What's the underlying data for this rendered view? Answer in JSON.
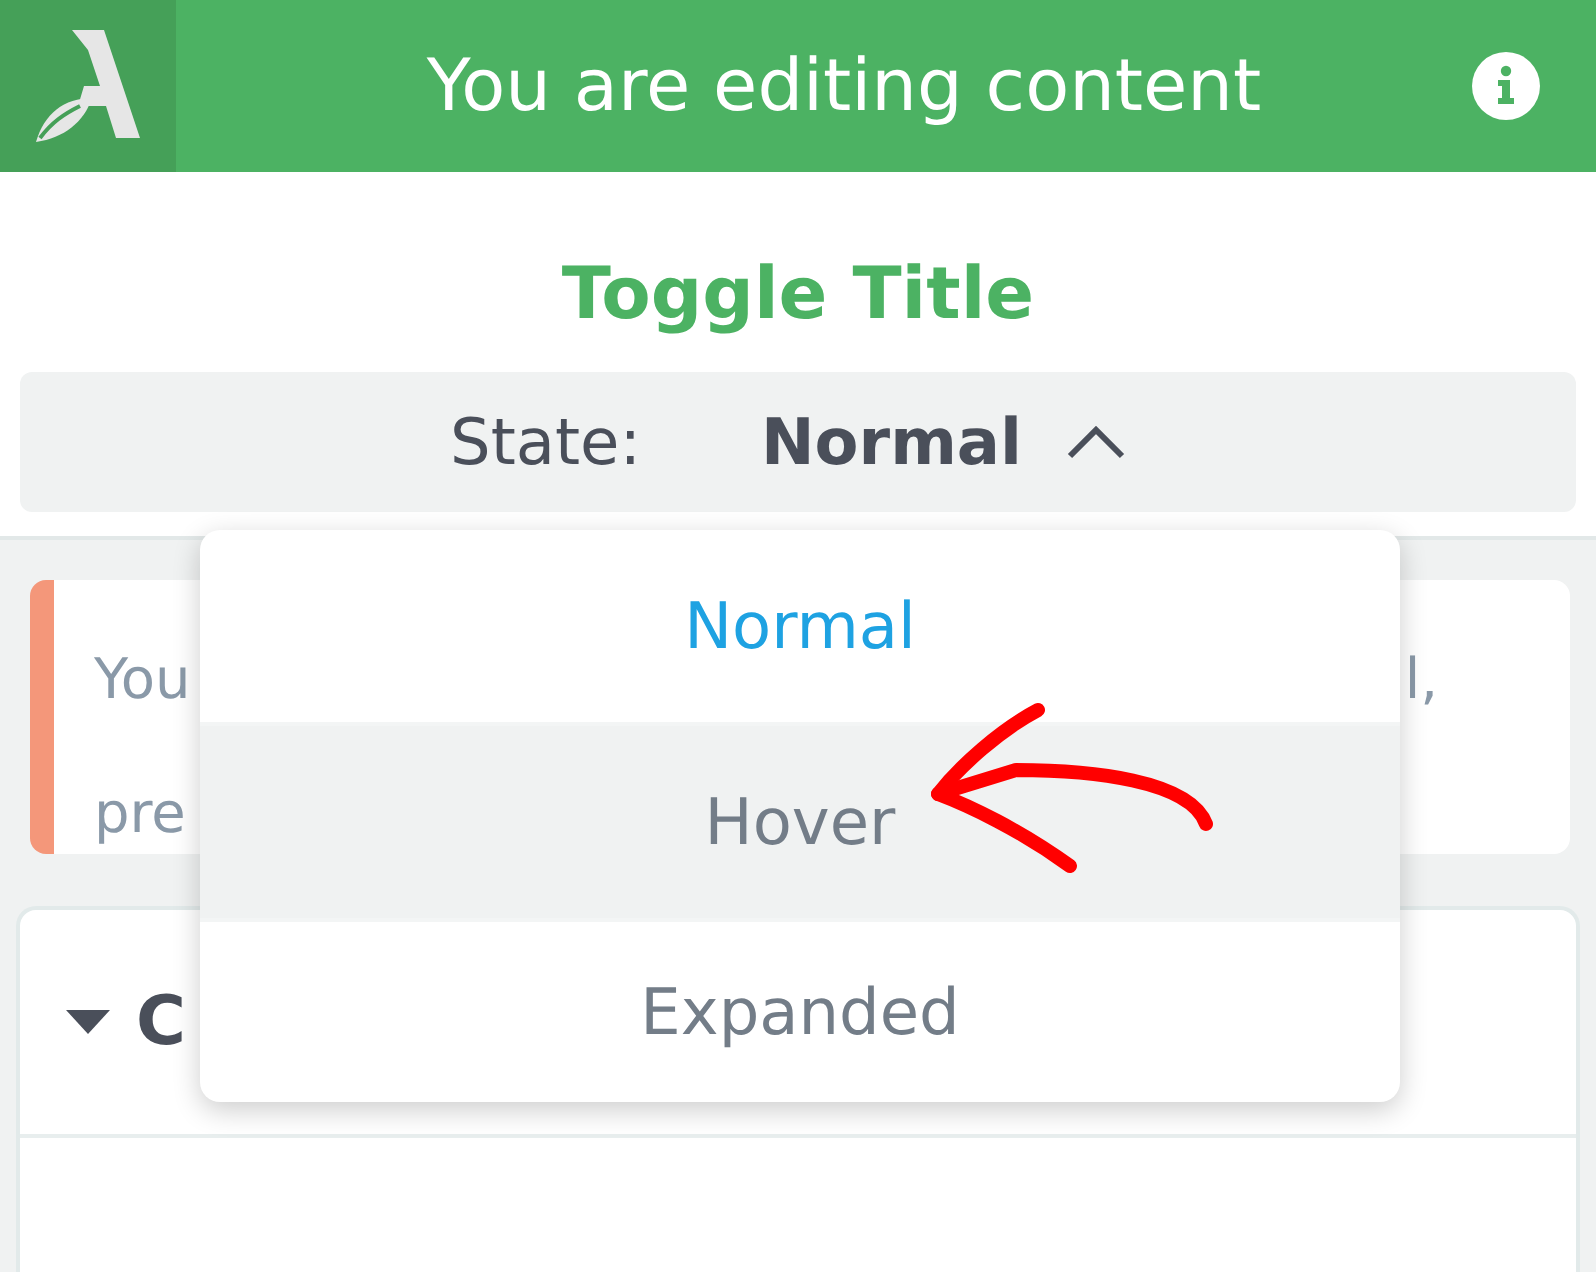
{
  "header": {
    "title": "You are editing content"
  },
  "block_title": "Toggle Title",
  "state_selector": {
    "label": "State:",
    "value": "Normal",
    "expanded": true
  },
  "notice": {
    "line_1_start": "You",
    "line_1_end": "l,",
    "line_2_start": "pre"
  },
  "section": {
    "expanded": true,
    "title_start": "C"
  },
  "dropdown": {
    "items": [
      {
        "label": "Normal",
        "selected": true,
        "hovered": false
      },
      {
        "label": "Hover",
        "selected": false,
        "hovered": true
      },
      {
        "label": "Expanded",
        "selected": false,
        "hovered": false
      }
    ]
  },
  "annotation": {
    "kind": "arrow",
    "color": "#ff0000"
  }
}
